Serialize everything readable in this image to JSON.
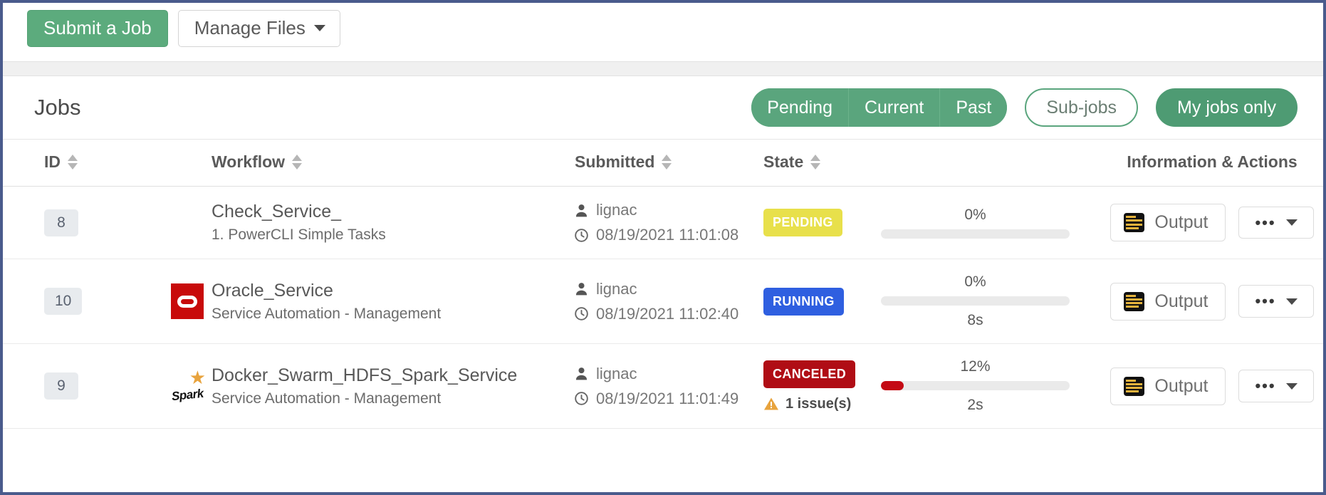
{
  "toolbar": {
    "submit_label": "Submit a Job",
    "manage_label": "Manage Files"
  },
  "jobs_header": {
    "title": "Jobs",
    "segments": [
      "Pending",
      "Current",
      "Past"
    ],
    "subjobs_label": "Sub-jobs",
    "myjobs_label": "My jobs only"
  },
  "table": {
    "columns": {
      "id": "ID",
      "logo": "",
      "workflow": "Workflow",
      "submitted": "Submitted",
      "state": "State",
      "progress": "",
      "info": "Information & Actions"
    },
    "rows": [
      {
        "id": "8",
        "logo": "none",
        "workflow": "Check_Service_",
        "workflow_sub": "1. PowerCLI Simple Tasks",
        "user": "lignac",
        "timestamp": "08/19/2021 11:01:08",
        "state": "PENDING",
        "state_kind": "pending",
        "issues": "",
        "progress_pct": "0%",
        "progress_value": 0,
        "elapsed": "",
        "output_label": "Output"
      },
      {
        "id": "10",
        "logo": "oracle",
        "workflow": "Oracle_Service",
        "workflow_sub": "Service Automation - Management",
        "user": "lignac",
        "timestamp": "08/19/2021 11:02:40",
        "state": "RUNNING",
        "state_kind": "running",
        "issues": "",
        "progress_pct": "0%",
        "progress_value": 0,
        "elapsed": "8s",
        "output_label": "Output"
      },
      {
        "id": "9",
        "logo": "spark",
        "workflow": "Docker_Swarm_HDFS_Spark_Service",
        "workflow_sub": "Service Automation - Management",
        "user": "lignac",
        "timestamp": "08/19/2021 11:01:49",
        "state": "CANCELED",
        "state_kind": "canceled",
        "issues": "1 issue(s)",
        "progress_pct": "12%",
        "progress_value": 12,
        "elapsed": "2s",
        "output_label": "Output"
      }
    ]
  },
  "colors": {
    "brand_green": "#5aa57d",
    "pending": "#e8e04b",
    "running": "#2f5fe0",
    "canceled": "#b00d15",
    "progress_fill": "#c40a14",
    "frame": "#4a5b8c"
  },
  "logos": {
    "spark_text": "Spark"
  }
}
